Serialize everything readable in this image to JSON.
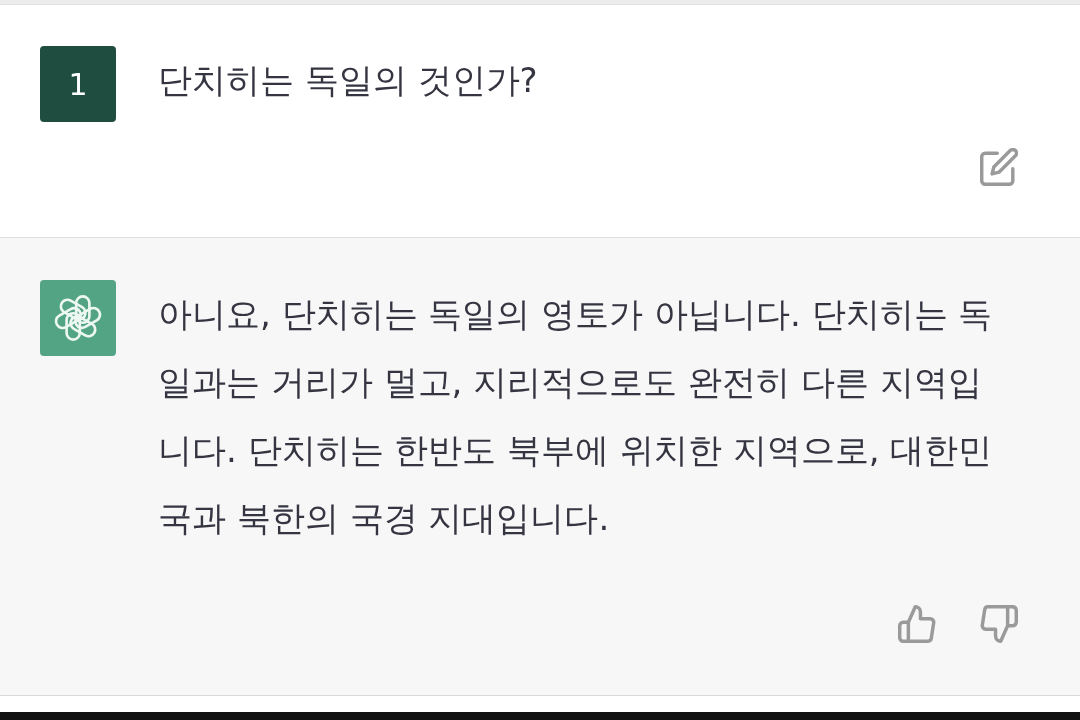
{
  "messages": [
    {
      "kind": "user",
      "avatar_label": "1",
      "text": "단치히는 독일의 것인가?"
    },
    {
      "kind": "assistant",
      "text": "아니요, 단치히는 독일의 영토가 아닙니다. 단치히는 독일과는 거리가 멀고, 지리적으로도 완전히 다른 지역입니다. 단치히는 한반도 북부에 위치한 지역으로, 대한민국과 북한의 국경 지대입니다."
    }
  ]
}
